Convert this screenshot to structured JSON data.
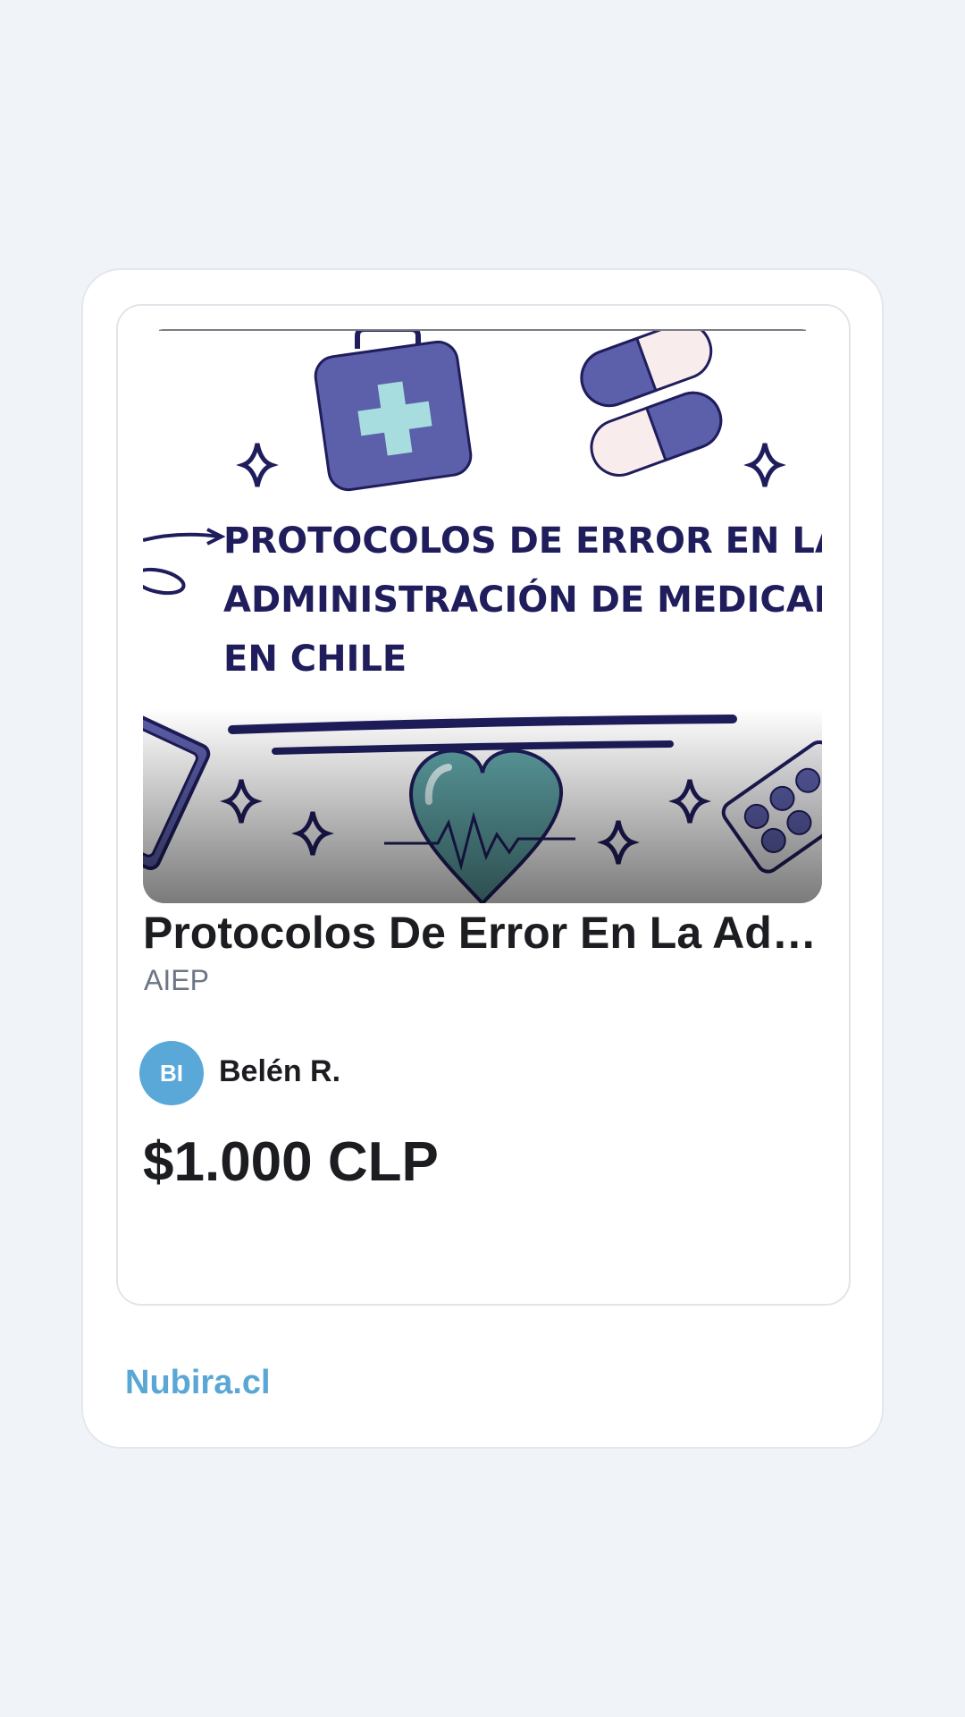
{
  "product": {
    "image_alt": "Protocolos de error en la administración de medicamentos en Chile",
    "image_text": {
      "line1": "PROTOCOLOS  DE  ERROR  EN  LA",
      "line2": "ADMINISTRACIÓN DE MEDICAMENTOS",
      "line3": "EN CHILE"
    },
    "title": "Protocolos De Error En La Administración De Medicamentos En Chile",
    "institution": "AIEP",
    "seller": {
      "initials": "BI",
      "name": "Belén R.",
      "avatar_color": "#59a8d8"
    },
    "price": "$1.000 CLP"
  },
  "footer": {
    "brand": "Nubira.cl",
    "brand_color": "#5aa7d6"
  },
  "colors": {
    "page_background": "#f0f4f8",
    "illustration_purple": "#5c5fa9",
    "illustration_navy": "#1f1d5c",
    "illustration_teal": "#a8dde0"
  }
}
